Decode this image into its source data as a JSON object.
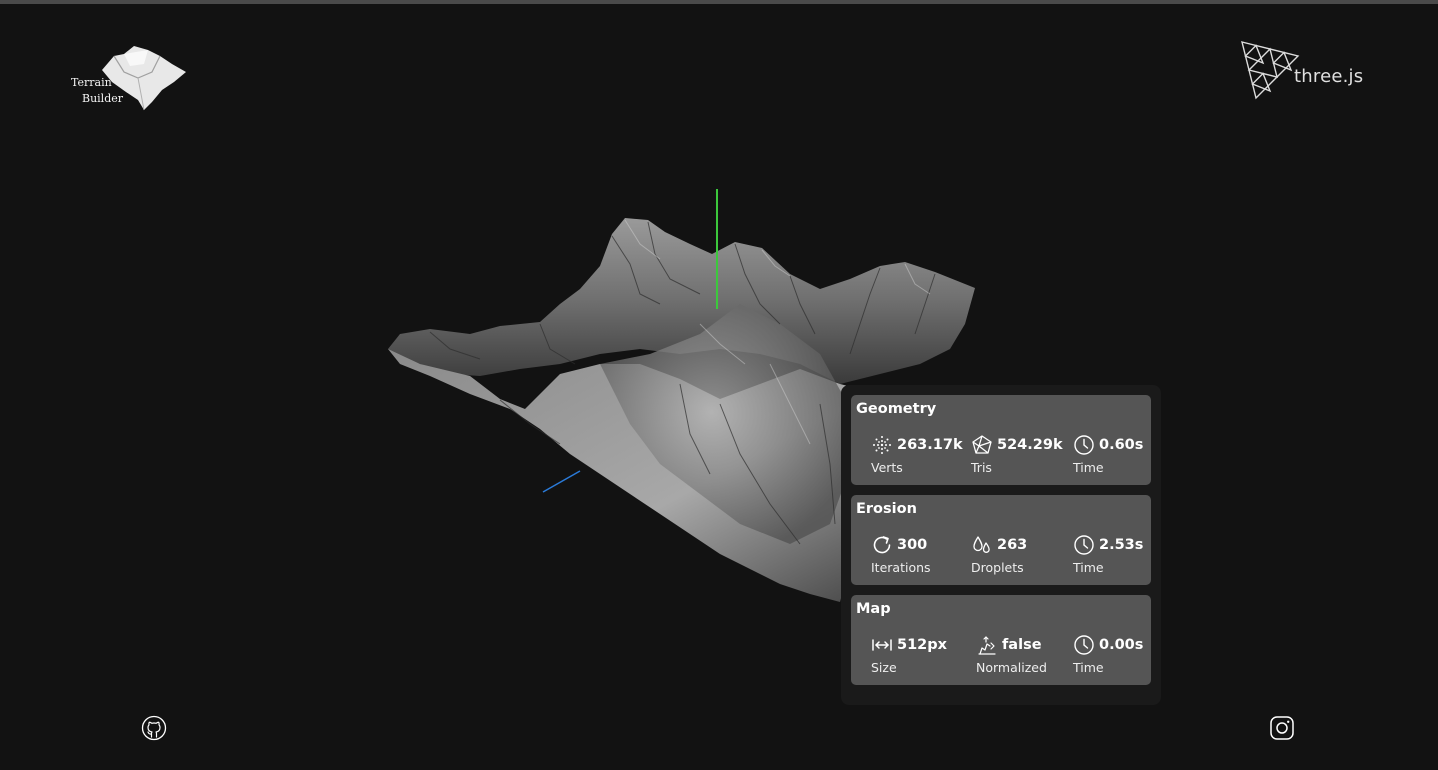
{
  "app": {
    "logo_line1": "Terrain",
    "logo_line2": "Builder",
    "engine_logo_text": "three.js"
  },
  "axes": {
    "y_axis_color": "#3cc83c",
    "x_axis_color": "#2a7ad8"
  },
  "stats": {
    "geometry": {
      "title": "Geometry",
      "items": [
        {
          "icon": "vertices-icon",
          "value": "263.17k",
          "label": "Verts"
        },
        {
          "icon": "triangles-icon",
          "value": "524.29k",
          "label": "Tris"
        },
        {
          "icon": "clock-icon",
          "value": "0.60s",
          "label": "Time"
        }
      ]
    },
    "erosion": {
      "title": "Erosion",
      "items": [
        {
          "icon": "refresh-icon",
          "value": "300",
          "label": "Iterations"
        },
        {
          "icon": "droplets-icon",
          "value": "263",
          "label": "Droplets"
        },
        {
          "icon": "clock-icon",
          "value": "2.53s",
          "label": "Time"
        }
      ]
    },
    "map": {
      "title": "Map",
      "items": [
        {
          "icon": "width-arrows-icon",
          "value": "512px",
          "label": "Size"
        },
        {
          "icon": "normalize-icon",
          "value": "false",
          "label": "Normalized"
        },
        {
          "icon": "clock-icon",
          "value": "0.00s",
          "label": "Time"
        }
      ]
    }
  },
  "footer": {
    "left_icon": "github-icon",
    "right_icon": "instagram-icon"
  }
}
